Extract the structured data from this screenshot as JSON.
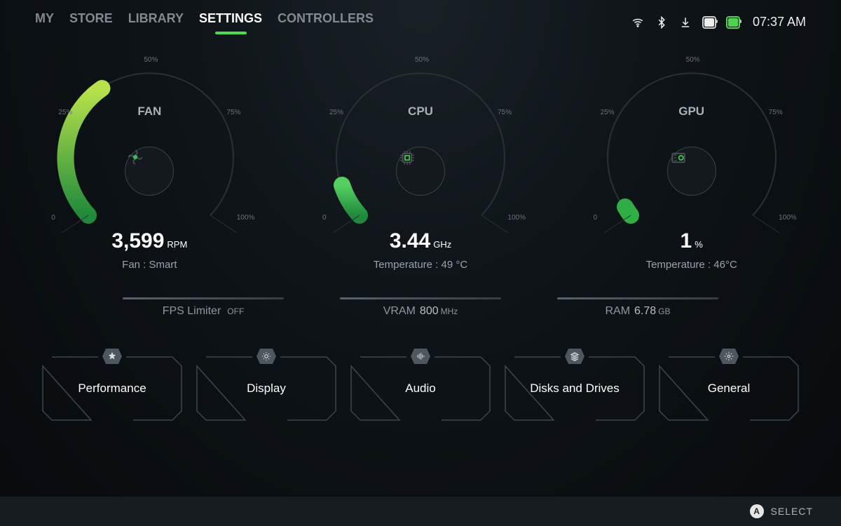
{
  "nav": {
    "tabs": [
      {
        "label": "MY",
        "active": false
      },
      {
        "label": "STORE",
        "active": false
      },
      {
        "label": "LIBRARY",
        "active": false
      },
      {
        "label": "SETTINGS",
        "active": true
      },
      {
        "label": "CONTROLLERS",
        "active": false
      }
    ]
  },
  "status": {
    "clock": "07:37 AM"
  },
  "gauges": {
    "ticks": [
      "0",
      "25%",
      "50%",
      "75%",
      "100%"
    ],
    "fan": {
      "title": "FAN",
      "value": "3,599",
      "unit": "RPM",
      "subtitle": "Fan : Smart",
      "percent": 36,
      "icon": "fan-icon"
    },
    "cpu": {
      "title": "CPU",
      "value": "3.44",
      "unit": "GHz",
      "subtitle": "Temperature : 49 °C",
      "percent": 9,
      "icon": "cpu-icon"
    },
    "gpu": {
      "title": "GPU",
      "value": "1",
      "unit": "%",
      "subtitle": "Temperature : 46°C",
      "percent": 1,
      "icon": "gpu-icon"
    }
  },
  "indicators": {
    "fps": {
      "label": "FPS Limiter",
      "value": "OFF",
      "unit": ""
    },
    "vram": {
      "label": "VRAM",
      "value": "800",
      "unit": "MHz"
    },
    "ram": {
      "label": "RAM",
      "value": "6.78",
      "unit": "GB"
    }
  },
  "tiles": [
    {
      "label": "Performance",
      "icon": "rocket-icon"
    },
    {
      "label": "Display",
      "icon": "brightness-icon"
    },
    {
      "label": "Audio",
      "icon": "equalizer-icon"
    },
    {
      "label": "Disks and Drives",
      "icon": "stack-icon"
    },
    {
      "label": "General",
      "icon": "gear-icon"
    }
  ],
  "footer": {
    "button_glyph": "A",
    "action": "SELECT"
  },
  "colors": {
    "accent": "#4ade4a"
  }
}
